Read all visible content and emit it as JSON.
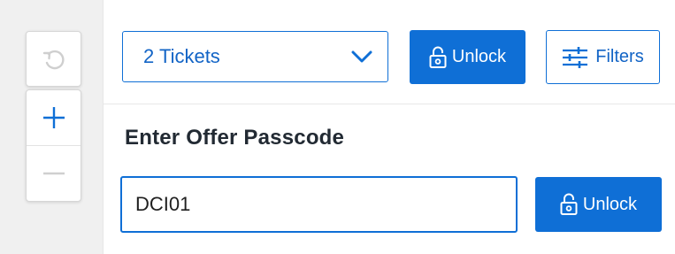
{
  "map_controls": {
    "reset_icon": "rotate-ccw-icon",
    "zoom_in_icon": "plus-icon",
    "zoom_out_icon": "minus-icon"
  },
  "filter_bar": {
    "ticket_quantity": {
      "selected": "2 Tickets",
      "icon": "chevron-down-icon"
    },
    "unlock_button": {
      "label": "Unlock",
      "icon": "unlock-icon"
    },
    "filters_button": {
      "label": "Filters",
      "icon": "sliders-icon"
    }
  },
  "passcode": {
    "heading": "Enter Offer Passcode",
    "input_value": "DCI01",
    "unlock_button": {
      "label": "Unlock",
      "icon": "unlock-icon"
    }
  },
  "colors": {
    "accent": "#0f6fd6",
    "accent_text": "#1264c6",
    "heading": "#222a33",
    "gutter_bg": "#f0f0f0"
  }
}
